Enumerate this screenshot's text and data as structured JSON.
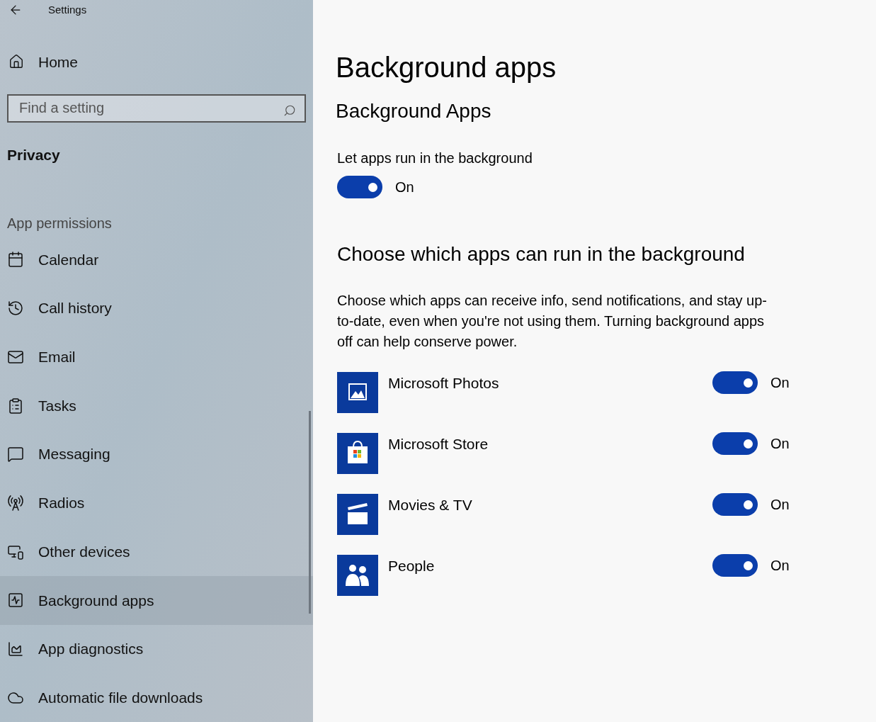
{
  "window": {
    "title": "Settings"
  },
  "sidebar": {
    "home": "Home",
    "search": {
      "placeholder": "Find a setting"
    },
    "section": "Privacy",
    "group": "App permissions",
    "items": [
      {
        "kind": "calendar",
        "label": "Calendar",
        "selected": false
      },
      {
        "kind": "history",
        "label": "Call history",
        "selected": false
      },
      {
        "kind": "email",
        "label": "Email",
        "selected": false
      },
      {
        "kind": "tasks",
        "label": "Tasks",
        "selected": false
      },
      {
        "kind": "messaging",
        "label": "Messaging",
        "selected": false
      },
      {
        "kind": "radios",
        "label": "Radios",
        "selected": false
      },
      {
        "kind": "devices",
        "label": "Other devices",
        "selected": false
      },
      {
        "kind": "background",
        "label": "Background apps",
        "selected": true
      },
      {
        "kind": "diagnostics",
        "label": "App diagnostics",
        "selected": false
      },
      {
        "kind": "cloud",
        "label": "Automatic file downloads",
        "selected": false
      }
    ]
  },
  "page": {
    "title": "Background apps",
    "subtitle": "Background Apps",
    "master": {
      "label": "Let apps run in the background",
      "on": true,
      "state": "On"
    },
    "heading": "Choose which apps can run in the background",
    "description": "Choose which apps can receive info, send notifications, and stay up-to-date, even when you're not using them. Turning background apps off can help conserve power.",
    "apps": [
      {
        "kind": "photos",
        "name": "Microsoft Photos",
        "on": true,
        "state": "On"
      },
      {
        "kind": "store",
        "name": "Microsoft Store",
        "on": true,
        "state": "On"
      },
      {
        "kind": "movies",
        "name": "Movies & TV",
        "on": true,
        "state": "On"
      },
      {
        "kind": "people",
        "name": "People",
        "on": true,
        "state": "On"
      }
    ]
  }
}
